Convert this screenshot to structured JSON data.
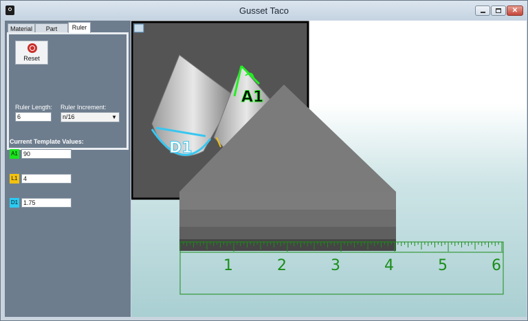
{
  "window": {
    "title": "Gusset Taco",
    "controls": {
      "minimize_icon": "minimize-icon",
      "maximize_icon": "maximize-icon",
      "close_icon": "close-icon"
    }
  },
  "tabs": [
    {
      "label": "Material",
      "active": false
    },
    {
      "label": "Part Details",
      "active": false
    },
    {
      "label": "Ruler",
      "active": true
    }
  ],
  "ruler_panel": {
    "reset_label": "Reset",
    "ruler_length_label": "Ruler Length:",
    "ruler_length_value": "6",
    "ruler_increment_label": "Ruler Increment:",
    "ruler_increment_value": "n/16"
  },
  "template": {
    "title": "Current Template Values:",
    "values": [
      {
        "label": "A1",
        "value": "90",
        "color": "#19e51c"
      },
      {
        "label": "L1",
        "value": "4",
        "color": "#f2c20e"
      },
      {
        "label": "D1",
        "value": "1.75",
        "color": "#2ccaf2"
      }
    ]
  },
  "ruler": {
    "numbers": [
      "1",
      "2",
      "3",
      "4",
      "5",
      "6"
    ],
    "color": "#1a8d18"
  },
  "diagram": {
    "labels": [
      "A1",
      "D1"
    ],
    "colors": {
      "angle": "#22ee22",
      "diameter": "#38c6f0",
      "length": "#f2c20e"
    }
  }
}
